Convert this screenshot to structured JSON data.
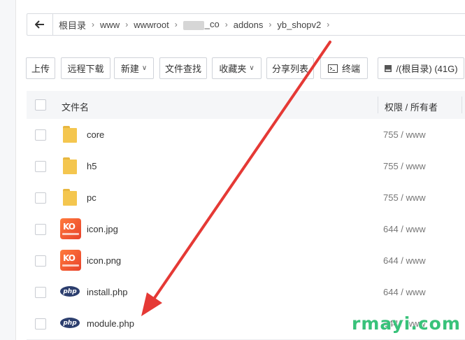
{
  "breadcrumb": {
    "back_icon": "arrow-left-icon",
    "items": [
      {
        "label": "根目录"
      },
      {
        "label": "www"
      },
      {
        "label": "wwwroot"
      },
      {
        "label": "_co"
      },
      {
        "label": "addons"
      },
      {
        "label": "yb_shopv2"
      }
    ]
  },
  "toolbar": {
    "upload": "上传",
    "remote_download": "远程下载",
    "new": "新建",
    "find_file": "文件查找",
    "favorites": "收藏夹",
    "share_list": "分享列表",
    "terminal": "终端",
    "disk": "/(根目录) (41G)"
  },
  "table": {
    "col_name": "文件名",
    "col_perm": "权限 / 所有者"
  },
  "files": [
    {
      "name": "core",
      "perm": "755 / www",
      "type": "folder"
    },
    {
      "name": "h5",
      "perm": "755 / www",
      "type": "folder"
    },
    {
      "name": "pc",
      "perm": "755 / www",
      "type": "folder"
    },
    {
      "name": "icon.jpg",
      "perm": "644 / www",
      "type": "image"
    },
    {
      "name": "icon.png",
      "perm": "644 / www",
      "type": "image"
    },
    {
      "name": "install.php",
      "perm": "644 / www",
      "type": "php"
    },
    {
      "name": "module.php",
      "perm": "644 / www",
      "type": "php"
    }
  ],
  "colors": {
    "arrow": "#e53935",
    "folder": "#f4c64f",
    "watermark": "#38c27a"
  },
  "watermark": "rmayi.com"
}
